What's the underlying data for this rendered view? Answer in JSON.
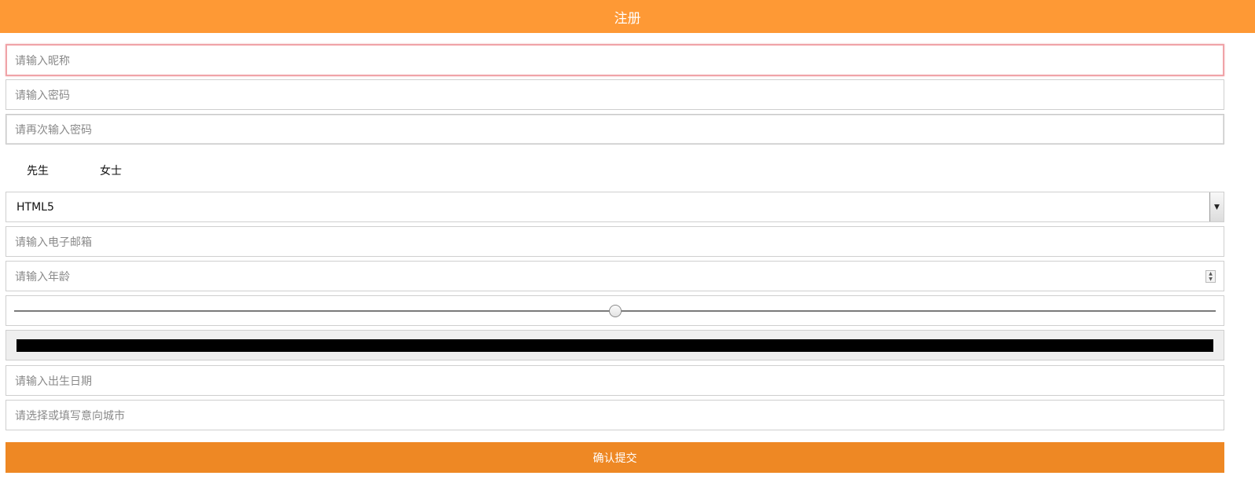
{
  "header": {
    "title": "注册"
  },
  "form": {
    "nickname_placeholder": "请输入昵称",
    "password_placeholder": "请输入密码",
    "confirm_password_placeholder": "请再次输入密码",
    "gender_options": [
      "先生",
      "女士"
    ],
    "course_select_value": "HTML5",
    "email_placeholder": "请输入电子邮箱",
    "age_placeholder": "请输入年龄",
    "range_value_fraction": 0.5,
    "color_value": "#000000",
    "birthdate_placeholder": "请输入出生日期",
    "city_placeholder": "请选择或填写意向城市",
    "submit_label": "确认提交"
  },
  "colors": {
    "header_bg": "#fe9935",
    "submit_bg": "#ee8824",
    "focus_border": "#f0a3a8"
  },
  "icons": {
    "select_arrow": "chevron-down-icon",
    "spinner": "spinner-icon"
  }
}
